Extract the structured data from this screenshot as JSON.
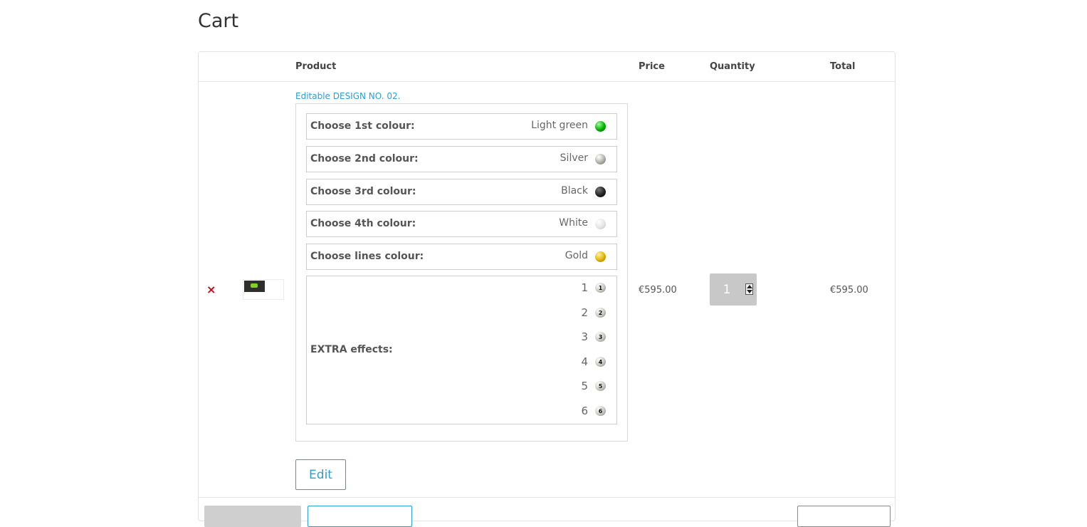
{
  "page": {
    "title": "Cart"
  },
  "table": {
    "headers": {
      "product": "Product",
      "price": "Price",
      "quantity": "Quantity",
      "total": "Total"
    }
  },
  "item": {
    "remove_symbol": "×",
    "product_name": "Editable DESIGN NO. 02.",
    "options": [
      {
        "label": "Choose 1st colour:",
        "value": "Light green",
        "swatch_color": "#00b000"
      },
      {
        "label": "Choose 2nd colour:",
        "value": "Silver",
        "swatch_color": "#b0b0a8"
      },
      {
        "label": "Choose 3rd colour:",
        "value": "Black",
        "swatch_color": "#222222"
      },
      {
        "label": "Choose 4th colour:",
        "value": "White",
        "swatch_color": "#e2e2e2"
      },
      {
        "label": "Choose lines colour:",
        "value": "Gold",
        "swatch_color": "#e0b400"
      }
    ],
    "extra": {
      "label": "EXTRA effects:",
      "effects": [
        "1",
        "2",
        "3",
        "4",
        "5",
        "6"
      ]
    },
    "edit_label": "Edit",
    "price": "€595.00",
    "quantity": "1",
    "total": "€595.00"
  },
  "colors": {
    "accent": "#2a9fd6",
    "remove": "#d0021b"
  }
}
